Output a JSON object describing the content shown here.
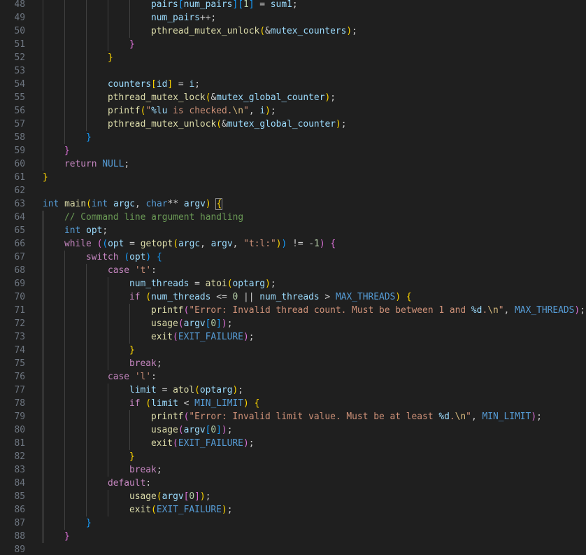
{
  "editor": {
    "language": "c",
    "first_line_number": 48,
    "colors": {
      "background": "#1f1f1f",
      "line_number": "#6e7681",
      "keyword": "#569cd6",
      "control_keyword": "#c586c0",
      "function": "#dcdcaa",
      "variable": "#9cdcfe",
      "string": "#ce9178",
      "number": "#b5cea8",
      "comment": "#6a9955",
      "bracket_level_1": "#ffd700",
      "bracket_level_2": "#da70d6",
      "bracket_level_3": "#179fff"
    },
    "lines": [
      {
        "number": "48",
        "tokens": [
          [
            "var",
            "pairs"
          ],
          [
            "b3",
            "["
          ],
          [
            "var",
            "num_pairs"
          ],
          [
            "b3",
            "]"
          ],
          [
            "b3",
            "["
          ],
          [
            "num",
            "1"
          ],
          [
            "b3",
            "]"
          ],
          [
            "p",
            " = "
          ],
          [
            "var",
            "sum1"
          ],
          [
            "p",
            ";"
          ]
        ]
      },
      {
        "number": "49",
        "tokens": [
          [
            "var",
            "num_pairs"
          ],
          [
            "p",
            "++;"
          ]
        ]
      },
      {
        "number": "50",
        "tokens": [
          [
            "fn",
            "pthread_mutex_unlock"
          ],
          [
            "b1",
            "("
          ],
          [
            "p",
            "&"
          ],
          [
            "var",
            "mutex_counters"
          ],
          [
            "b1",
            ")"
          ],
          [
            "p",
            ";"
          ]
        ]
      },
      {
        "number": "51",
        "tokens": [
          [
            "b2",
            "}"
          ]
        ]
      },
      {
        "number": "52",
        "tokens": [
          [
            "b1",
            "}"
          ]
        ]
      },
      {
        "number": "53",
        "tokens": []
      },
      {
        "number": "54",
        "tokens": [
          [
            "var",
            "counters"
          ],
          [
            "b1",
            "["
          ],
          [
            "var",
            "id"
          ],
          [
            "b1",
            "]"
          ],
          [
            "p",
            " = "
          ],
          [
            "var",
            "i"
          ],
          [
            "p",
            ";"
          ]
        ]
      },
      {
        "number": "55",
        "tokens": [
          [
            "fn",
            "pthread_mutex_lock"
          ],
          [
            "b1",
            "("
          ],
          [
            "p",
            "&"
          ],
          [
            "var",
            "mutex_global_counter"
          ],
          [
            "b1",
            ")"
          ],
          [
            "p",
            ";"
          ]
        ]
      },
      {
        "number": "56",
        "tokens": [
          [
            "fn",
            "printf"
          ],
          [
            "b1",
            "("
          ],
          [
            "str",
            "\""
          ],
          [
            "fmt",
            "%lu"
          ],
          [
            "str",
            " is checked."
          ],
          [
            "esc",
            "\\n"
          ],
          [
            "str",
            "\""
          ],
          [
            "p",
            ", "
          ],
          [
            "var",
            "i"
          ],
          [
            "b1",
            ")"
          ],
          [
            "p",
            ";"
          ]
        ]
      },
      {
        "number": "57",
        "tokens": [
          [
            "fn",
            "pthread_mutex_unlock"
          ],
          [
            "b1",
            "("
          ],
          [
            "p",
            "&"
          ],
          [
            "var",
            "mutex_global_counter"
          ],
          [
            "b1",
            ")"
          ],
          [
            "p",
            ";"
          ]
        ]
      },
      {
        "number": "58",
        "tokens": [
          [
            "b3",
            "}"
          ]
        ]
      },
      {
        "number": "59",
        "tokens": [
          [
            "b2",
            "}"
          ]
        ]
      },
      {
        "number": "60",
        "tokens": [
          [
            "ctl",
            "return"
          ],
          [
            "p",
            " "
          ],
          [
            "mac",
            "NULL"
          ],
          [
            "p",
            ";"
          ]
        ]
      },
      {
        "number": "61",
        "tokens": [
          [
            "b1",
            "}"
          ]
        ]
      },
      {
        "number": "62",
        "tokens": []
      },
      {
        "number": "63",
        "tokens": [
          [
            "kw",
            "int"
          ],
          [
            "p",
            " "
          ],
          [
            "fn",
            "main"
          ],
          [
            "b1",
            "("
          ],
          [
            "kw",
            "int"
          ],
          [
            "p",
            " "
          ],
          [
            "var",
            "argc"
          ],
          [
            "p",
            ", "
          ],
          [
            "kw",
            "char"
          ],
          [
            "p",
            "** "
          ],
          [
            "var",
            "argv"
          ],
          [
            "b1",
            ")"
          ],
          [
            "p",
            " "
          ],
          [
            "match",
            "{"
          ]
        ]
      },
      {
        "number": "64",
        "tokens": [
          [
            "com",
            "// Command line argument handling"
          ]
        ]
      },
      {
        "number": "65",
        "tokens": [
          [
            "kw",
            "int"
          ],
          [
            "p",
            " "
          ],
          [
            "var",
            "opt"
          ],
          [
            "p",
            ";"
          ]
        ]
      },
      {
        "number": "66",
        "tokens": [
          [
            "ctl",
            "while"
          ],
          [
            "p",
            " "
          ],
          [
            "b2",
            "("
          ],
          [
            "b3",
            "("
          ],
          [
            "var",
            "opt"
          ],
          [
            "p",
            " = "
          ],
          [
            "fn",
            "getopt"
          ],
          [
            "b1",
            "("
          ],
          [
            "var",
            "argc"
          ],
          [
            "p",
            ", "
          ],
          [
            "var",
            "argv"
          ],
          [
            "p",
            ", "
          ],
          [
            "str",
            "\"t:l:\""
          ],
          [
            "b1",
            ")"
          ],
          [
            "b3",
            ")"
          ],
          [
            "p",
            " != -"
          ],
          [
            "num",
            "1"
          ],
          [
            "b2",
            ")"
          ],
          [
            "p",
            " "
          ],
          [
            "b2",
            "{"
          ]
        ]
      },
      {
        "number": "67",
        "tokens": [
          [
            "ctl",
            "switch"
          ],
          [
            "p",
            " "
          ],
          [
            "b3",
            "("
          ],
          [
            "var",
            "opt"
          ],
          [
            "b3",
            ")"
          ],
          [
            "p",
            " "
          ],
          [
            "b3",
            "{"
          ]
        ]
      },
      {
        "number": "68",
        "tokens": [
          [
            "ctl",
            "case"
          ],
          [
            "p",
            " "
          ],
          [
            "str",
            "'t'"
          ],
          [
            "p",
            ":"
          ]
        ]
      },
      {
        "number": "69",
        "tokens": [
          [
            "var",
            "num_threads"
          ],
          [
            "p",
            " = "
          ],
          [
            "fn",
            "atoi"
          ],
          [
            "b1",
            "("
          ],
          [
            "var",
            "optarg"
          ],
          [
            "b1",
            ")"
          ],
          [
            "p",
            ";"
          ]
        ]
      },
      {
        "number": "70",
        "tokens": [
          [
            "ctl",
            "if"
          ],
          [
            "p",
            " "
          ],
          [
            "b1",
            "("
          ],
          [
            "var",
            "num_threads"
          ],
          [
            "p",
            " <= "
          ],
          [
            "num",
            "0"
          ],
          [
            "p",
            " || "
          ],
          [
            "var",
            "num_threads"
          ],
          [
            "p",
            " > "
          ],
          [
            "mac",
            "MAX_THREADS"
          ],
          [
            "b1",
            ")"
          ],
          [
            "p",
            " "
          ],
          [
            "b1",
            "{"
          ]
        ]
      },
      {
        "number": "71",
        "tokens": [
          [
            "fn",
            "printf"
          ],
          [
            "b2",
            "("
          ],
          [
            "str",
            "\"Error: Invalid thread count. Must be between 1 and "
          ],
          [
            "fmt",
            "%d"
          ],
          [
            "str",
            "."
          ],
          [
            "esc",
            "\\n"
          ],
          [
            "str",
            "\""
          ],
          [
            "p",
            ", "
          ],
          [
            "mac",
            "MAX_THREADS"
          ],
          [
            "b2",
            ")"
          ],
          [
            "p",
            ";"
          ]
        ]
      },
      {
        "number": "72",
        "tokens": [
          [
            "fn",
            "usage"
          ],
          [
            "b2",
            "("
          ],
          [
            "var",
            "argv"
          ],
          [
            "b3",
            "["
          ],
          [
            "num",
            "0"
          ],
          [
            "b3",
            "]"
          ],
          [
            "b2",
            ")"
          ],
          [
            "p",
            ";"
          ]
        ]
      },
      {
        "number": "73",
        "tokens": [
          [
            "fn",
            "exit"
          ],
          [
            "b2",
            "("
          ],
          [
            "mac",
            "EXIT_FAILURE"
          ],
          [
            "b2",
            ")"
          ],
          [
            "p",
            ";"
          ]
        ]
      },
      {
        "number": "74",
        "tokens": [
          [
            "b1",
            "}"
          ]
        ]
      },
      {
        "number": "75",
        "tokens": [
          [
            "ctl",
            "break"
          ],
          [
            "p",
            ";"
          ]
        ]
      },
      {
        "number": "76",
        "tokens": [
          [
            "ctl",
            "case"
          ],
          [
            "p",
            " "
          ],
          [
            "str",
            "'l'"
          ],
          [
            "p",
            ":"
          ]
        ]
      },
      {
        "number": "77",
        "tokens": [
          [
            "var",
            "limit"
          ],
          [
            "p",
            " = "
          ],
          [
            "fn",
            "atol"
          ],
          [
            "b1",
            "("
          ],
          [
            "var",
            "optarg"
          ],
          [
            "b1",
            ")"
          ],
          [
            "p",
            ";"
          ]
        ]
      },
      {
        "number": "78",
        "tokens": [
          [
            "ctl",
            "if"
          ],
          [
            "p",
            " "
          ],
          [
            "b1",
            "("
          ],
          [
            "var",
            "limit"
          ],
          [
            "p",
            " < "
          ],
          [
            "mac",
            "MIN_LIMIT"
          ],
          [
            "b1",
            ")"
          ],
          [
            "p",
            " "
          ],
          [
            "b1",
            "{"
          ]
        ]
      },
      {
        "number": "79",
        "tokens": [
          [
            "fn",
            "printf"
          ],
          [
            "b2",
            "("
          ],
          [
            "str",
            "\"Error: Invalid limit value. Must be at least "
          ],
          [
            "fmt",
            "%d"
          ],
          [
            "str",
            "."
          ],
          [
            "esc",
            "\\n"
          ],
          [
            "str",
            "\""
          ],
          [
            "p",
            ", "
          ],
          [
            "mac",
            "MIN_LIMIT"
          ],
          [
            "b2",
            ")"
          ],
          [
            "p",
            ";"
          ]
        ]
      },
      {
        "number": "80",
        "tokens": [
          [
            "fn",
            "usage"
          ],
          [
            "b2",
            "("
          ],
          [
            "var",
            "argv"
          ],
          [
            "b3",
            "["
          ],
          [
            "num",
            "0"
          ],
          [
            "b3",
            "]"
          ],
          [
            "b2",
            ")"
          ],
          [
            "p",
            ";"
          ]
        ]
      },
      {
        "number": "81",
        "tokens": [
          [
            "fn",
            "exit"
          ],
          [
            "b2",
            "("
          ],
          [
            "mac",
            "EXIT_FAILURE"
          ],
          [
            "b2",
            ")"
          ],
          [
            "p",
            ";"
          ]
        ]
      },
      {
        "number": "82",
        "tokens": [
          [
            "b1",
            "}"
          ]
        ]
      },
      {
        "number": "83",
        "tokens": [
          [
            "ctl",
            "break"
          ],
          [
            "p",
            ";"
          ]
        ]
      },
      {
        "number": "84",
        "tokens": [
          [
            "ctl",
            "default"
          ],
          [
            "p",
            ":"
          ]
        ]
      },
      {
        "number": "85",
        "tokens": [
          [
            "fn",
            "usage"
          ],
          [
            "b1",
            "("
          ],
          [
            "var",
            "argv"
          ],
          [
            "b2",
            "["
          ],
          [
            "num",
            "0"
          ],
          [
            "b2",
            "]"
          ],
          [
            "b1",
            ")"
          ],
          [
            "p",
            ";"
          ]
        ]
      },
      {
        "number": "86",
        "tokens": [
          [
            "fn",
            "exit"
          ],
          [
            "b1",
            "("
          ],
          [
            "mac",
            "EXIT_FAILURE"
          ],
          [
            "b1",
            ")"
          ],
          [
            "p",
            ";"
          ]
        ]
      },
      {
        "number": "87",
        "tokens": [
          [
            "b3",
            "}"
          ]
        ]
      },
      {
        "number": "88",
        "tokens": [
          [
            "b2",
            "}"
          ]
        ]
      },
      {
        "number": "89",
        "tokens": []
      }
    ]
  }
}
